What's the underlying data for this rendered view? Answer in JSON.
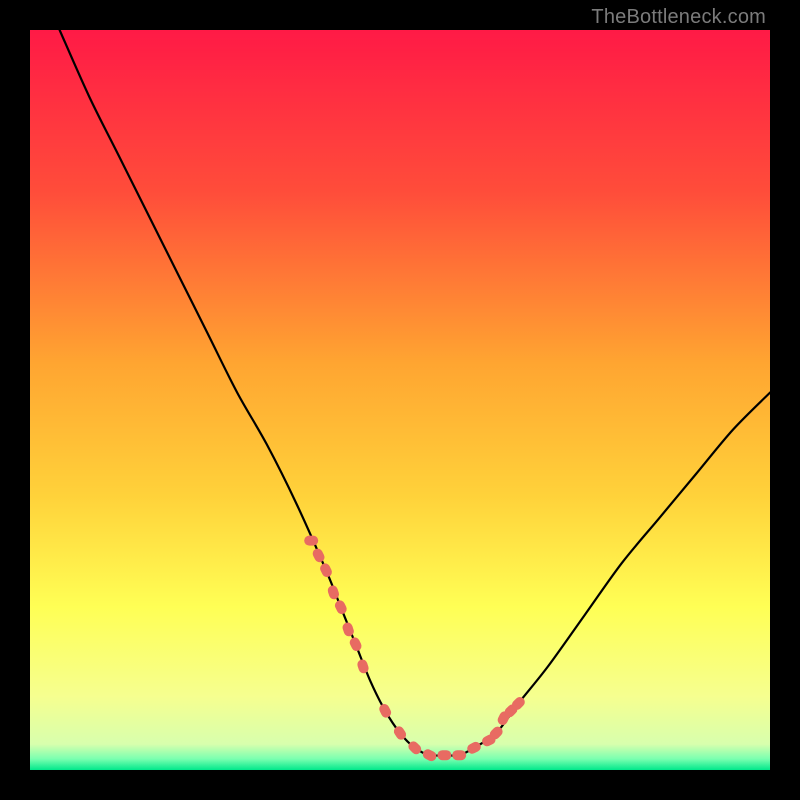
{
  "watermark": "TheBottleneck.com",
  "colors": {
    "background": "#000000",
    "gradient_top": "#ff1a46",
    "gradient_upper_mid": "#ff7a2a",
    "gradient_mid": "#ffd23a",
    "gradient_lower_mid": "#ffff55",
    "gradient_low": "#f6ff8f",
    "gradient_bottom": "#00e88b",
    "curve": "#000000",
    "dots": "#e86b62"
  },
  "chart_data": {
    "type": "line",
    "title": "",
    "xlabel": "",
    "ylabel": "",
    "xlim": [
      0,
      100
    ],
    "ylim": [
      0,
      100
    ],
    "grid": false,
    "legend": false,
    "series": [
      {
        "name": "bottleneck-curve",
        "x": [
          4,
          8,
          12,
          16,
          20,
          24,
          28,
          32,
          36,
          40,
          42,
          44,
          46,
          48,
          50,
          52,
          54,
          56,
          58,
          60,
          63,
          66,
          70,
          75,
          80,
          85,
          90,
          95,
          100
        ],
        "y": [
          100,
          91,
          83,
          75,
          67,
          59,
          51,
          44,
          36,
          27,
          22,
          17,
          12,
          8,
          5,
          3,
          2,
          2,
          2,
          3,
          5,
          9,
          14,
          21,
          28,
          34,
          40,
          46,
          51
        ]
      }
    ],
    "highlight_points": {
      "name": "highlight-dots",
      "x": [
        38,
        39,
        40,
        41,
        42,
        43,
        44,
        45,
        48,
        50,
        52,
        54,
        56,
        58,
        60,
        62,
        63,
        64,
        65,
        66
      ],
      "y": [
        31,
        29,
        27,
        24,
        22,
        19,
        17,
        14,
        8,
        5,
        3,
        2,
        2,
        2,
        3,
        4,
        5,
        7,
        8,
        9
      ]
    }
  }
}
